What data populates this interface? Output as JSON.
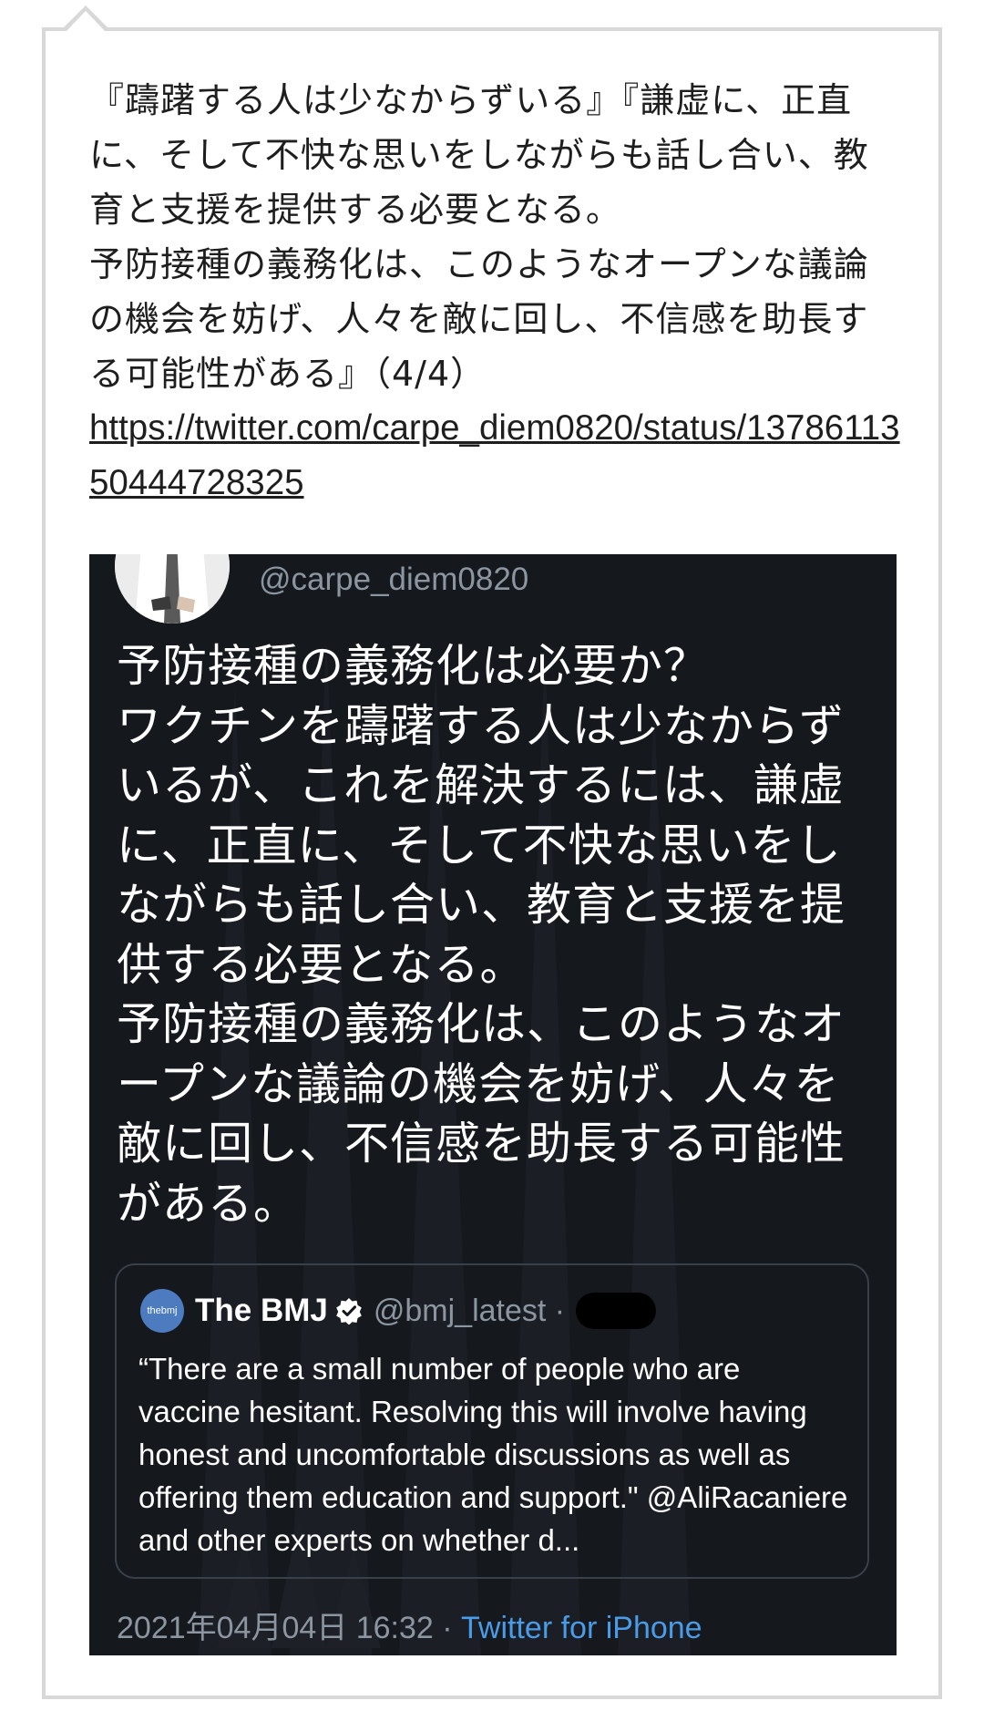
{
  "post": {
    "body_text": "『躊躇する人は少なからずいる』『謙虚に、正直に、そして不快な思いをしながらも話し合い、教育と支援を提供する必要となる。\n予防接種の義務化は、このようなオープンな議論の機会を妨げ、人々を敵に回し、不信感を助長する可能性がある』（4/4）",
    "link": "https://twitter.com/carpe_diem0820/status/1378611350444728325"
  },
  "tweet": {
    "handle": "@carpe_diem0820",
    "text": "予防接種の義務化は必要か？\nワクチンを躊躇する人は少なからずいるが、これを解決するには、謙虚に、正直に、そして不快な思いをしながらも話し合い、教育と支援を提供する必要となる。\n予防接種の義務化は、このようなオープンな議論の機会を妨げ、人々を敵に回し、不信感を助長する可能性がある。",
    "quote": {
      "logo_text": "thebmj",
      "name": "The BMJ",
      "handle": "@bmj_latest ·",
      "body": "“There are a small number of people who are vaccine hesitant. Resolving this will involve having honest and uncomfortable discussions as well as offering them education and support.\" @AliRacaniere and other experts on whether d..."
    },
    "footer": {
      "datetime": "2021年04月04日 16:32 · ",
      "app": "Twitter for iPhone"
    }
  },
  "colors": {
    "tweet_bg": "#15181d",
    "link_blue": "#4a9be8",
    "muted": "#8b96a1"
  }
}
